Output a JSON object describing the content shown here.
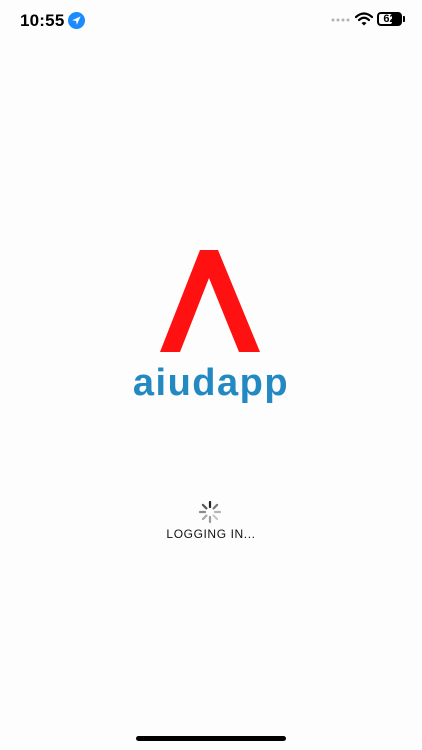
{
  "status_bar": {
    "time": "10:55",
    "battery_level": 62,
    "battery_label": "62",
    "icons": [
      "location-arrow-icon",
      "cellular-signal-icon",
      "wifi-icon",
      "battery-icon"
    ]
  },
  "logo": {
    "mark_icon": "aiudapp-a-mark-icon",
    "mark_color": "#ff1111",
    "wordmark": "aiudapp",
    "wordmark_color": "#2289c2"
  },
  "loading": {
    "spinner_icon": "activity-spinner-icon",
    "text": "LOGGING IN..."
  }
}
